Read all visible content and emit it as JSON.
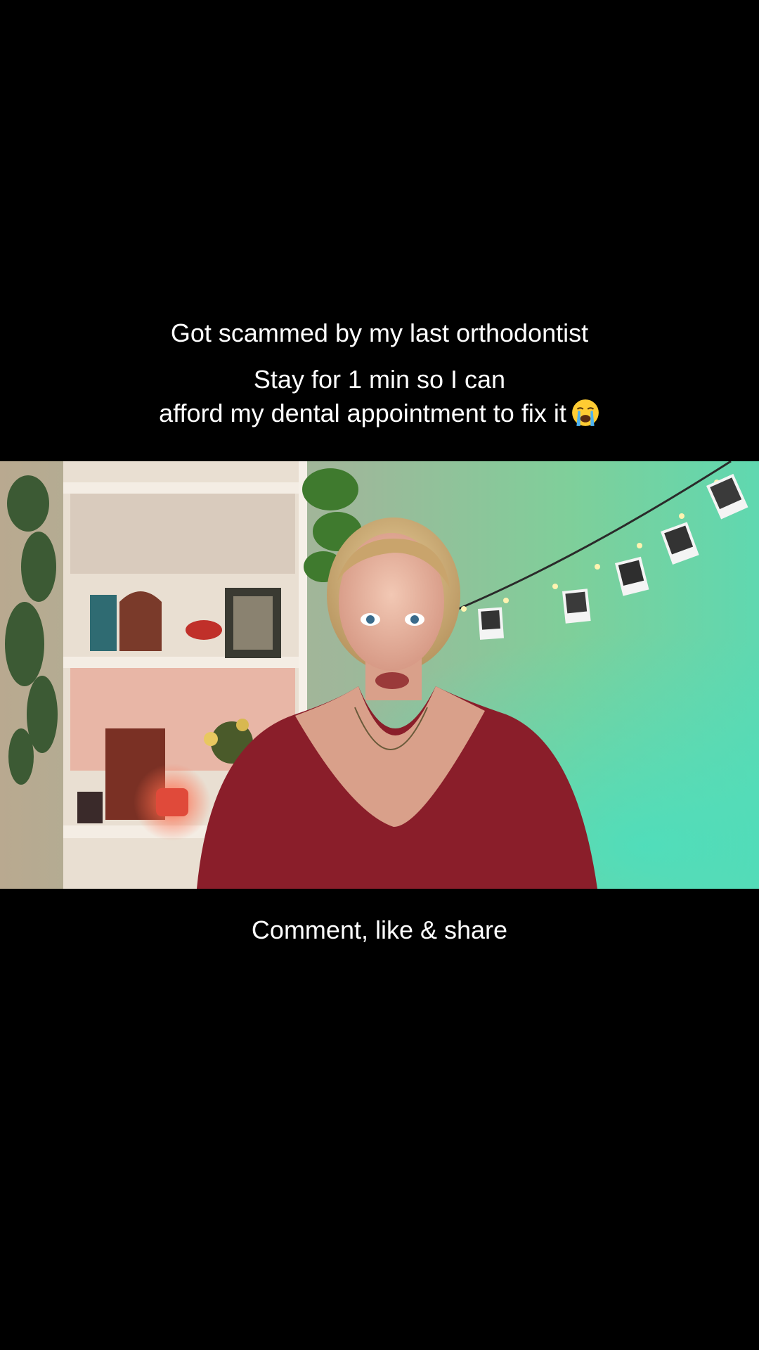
{
  "captions": {
    "line1": "Got scammed by my last orthodontist",
    "line2": "Stay for 1 min so I can",
    "line3": "afford my dental appointment to fix it",
    "bottom": "Comment, like & share"
  },
  "icons": {
    "emoji": "loudly-crying-face-icon"
  },
  "colors": {
    "background": "#000000",
    "caption_text": "#ffffff",
    "wall_green": "#7fcf9a",
    "shirt": "#8a1e2a"
  }
}
